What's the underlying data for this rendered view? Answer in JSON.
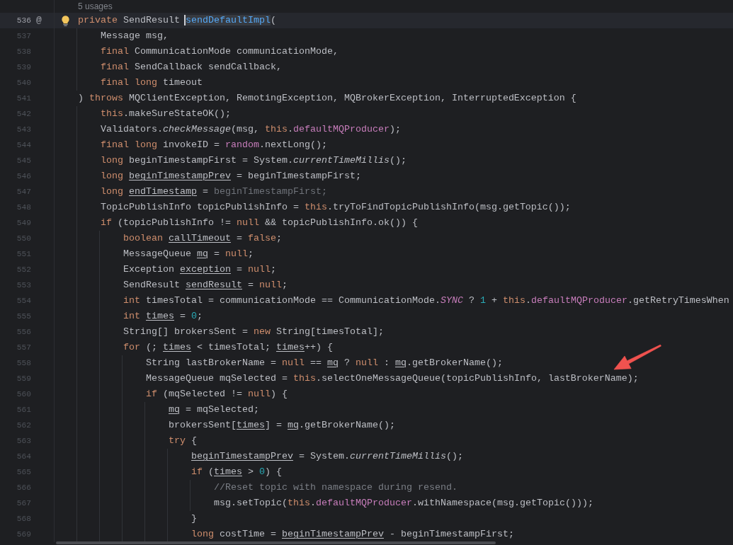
{
  "editor": {
    "lines": [
      {
        "number": "536",
        "current": true,
        "usages": "5 usages",
        "marker": "@",
        "tokens": [
          {
            "text": "private",
            "kind": "keyword"
          },
          {
            "text": " SendResult ",
            "kind": "text"
          },
          {
            "text": "sendDefaultImpl",
            "kind": "highlighted"
          },
          {
            "text": "(",
            "kind": "text"
          }
        ],
        "children": [
          {
            "number": "537",
            "current": false,
            "tokens": [
              {
                "text": "Message msg,",
                "kind": "text"
              }
            ]
          },
          {
            "number": "538",
            "current": false,
            "tokens": [
              {
                "text": "final",
                "kind": "keyword"
              },
              {
                "text": " CommunicationMode communicationMode,",
                "kind": "text"
              }
            ]
          },
          {
            "number": "539",
            "current": false,
            "tokens": [
              {
                "text": "final",
                "kind": "keyword"
              },
              {
                "text": " SendCallback sendCallback,",
                "kind": "text"
              }
            ]
          },
          {
            "number": "540",
            "current": false,
            "tokens": [
              {
                "text": "final long",
                "kind": "keyword"
              },
              {
                "text": " timeout",
                "kind": "text"
              }
            ]
          }
        ]
      },
      {
        "number": "541",
        "current": false,
        "tokens": [
          {
            "text": ") ",
            "kind": "text"
          },
          {
            "text": "throws",
            "kind": "keyword"
          },
          {
            "text": " MQClientException, RemotingException, MQBrokerException, InterruptedException {",
            "kind": "text"
          }
        ],
        "children": [
          {
            "number": "542",
            "current": false,
            "tokens": [
              {
                "text": "this",
                "kind": "keyword"
              },
              {
                "text": ".makeSureStateOK();",
                "kind": "text"
              }
            ]
          },
          {
            "number": "543",
            "current": false,
            "tokens": [
              {
                "text": "Validators.",
                "kind": "text"
              },
              {
                "text": "checkMessage",
                "kind": "static"
              },
              {
                "text": "(msg, ",
                "kind": "text"
              },
              {
                "text": "this",
                "kind": "keyword"
              },
              {
                "text": ".",
                "kind": "text"
              },
              {
                "text": "defaultMQProducer",
                "kind": "field"
              },
              {
                "text": ");",
                "kind": "text"
              }
            ]
          },
          {
            "number": "544",
            "current": false,
            "tokens": [
              {
                "text": "final long",
                "kind": "keyword"
              },
              {
                "text": " invokeID = ",
                "kind": "text"
              },
              {
                "text": "random",
                "kind": "field"
              },
              {
                "text": ".nextLong();",
                "kind": "text"
              }
            ]
          },
          {
            "number": "545",
            "current": false,
            "tokens": [
              {
                "text": "long",
                "kind": "keyword"
              },
              {
                "text": " beginTimestampFirst = System.",
                "kind": "text"
              },
              {
                "text": "currentTimeMillis",
                "kind": "static"
              },
              {
                "text": "();",
                "kind": "text"
              }
            ]
          },
          {
            "number": "546",
            "current": false,
            "tokens": [
              {
                "text": "long ",
                "kind": "keyword"
              },
              {
                "text": "beginTimestampPrev",
                "kind": "reassigned"
              },
              {
                "text": " = beginTimestampFirst;",
                "kind": "text"
              }
            ]
          },
          {
            "number": "547",
            "current": false,
            "tokens": [
              {
                "text": "long ",
                "kind": "keyword"
              },
              {
                "text": "endTimestamp",
                "kind": "reassigned"
              },
              {
                "text": " = ",
                "kind": "text"
              },
              {
                "text": "beginTimestampFirst;",
                "kind": "unused"
              }
            ]
          },
          {
            "number": "548",
            "current": false,
            "tokens": [
              {
                "text": "TopicPublishInfo topicPublishInfo = ",
                "kind": "text"
              },
              {
                "text": "this",
                "kind": "keyword"
              },
              {
                "text": ".tryToFindTopicPublishInfo(msg.getTopic());",
                "kind": "text"
              }
            ]
          },
          {
            "number": "549",
            "current": false,
            "tokens": [
              {
                "text": "if",
                "kind": "keyword"
              },
              {
                "text": " (topicPublishInfo != ",
                "kind": "text"
              },
              {
                "text": "null",
                "kind": "keyword"
              },
              {
                "text": " && topicPublishInfo.ok()) {",
                "kind": "text"
              }
            ],
            "children": [
              {
                "number": "550",
                "current": false,
                "tokens": [
                  {
                    "text": "boolean ",
                    "kind": "keyword"
                  },
                  {
                    "text": "callTimeout",
                    "kind": "reassigned"
                  },
                  {
                    "text": " = ",
                    "kind": "text"
                  },
                  {
                    "text": "false",
                    "kind": "keyword"
                  },
                  {
                    "text": ";",
                    "kind": "text"
                  }
                ]
              },
              {
                "number": "551",
                "current": false,
                "tokens": [
                  {
                    "text": "MessageQueue ",
                    "kind": "text"
                  },
                  {
                    "text": "mq",
                    "kind": "reassigned"
                  },
                  {
                    "text": " = ",
                    "kind": "text"
                  },
                  {
                    "text": "null",
                    "kind": "keyword"
                  },
                  {
                    "text": ";",
                    "kind": "text"
                  }
                ]
              },
              {
                "number": "552",
                "current": false,
                "tokens": [
                  {
                    "text": "Exception ",
                    "kind": "text"
                  },
                  {
                    "text": "exception",
                    "kind": "reassigned"
                  },
                  {
                    "text": " = ",
                    "kind": "text"
                  },
                  {
                    "text": "null",
                    "kind": "keyword"
                  },
                  {
                    "text": ";",
                    "kind": "text"
                  }
                ]
              },
              {
                "number": "553",
                "current": false,
                "tokens": [
                  {
                    "text": "SendResult ",
                    "kind": "text"
                  },
                  {
                    "text": "sendResult",
                    "kind": "reassigned"
                  },
                  {
                    "text": " = ",
                    "kind": "text"
                  },
                  {
                    "text": "null",
                    "kind": "keyword"
                  },
                  {
                    "text": ";",
                    "kind": "text"
                  }
                ]
              },
              {
                "number": "554",
                "current": false,
                "tokens": [
                  {
                    "text": "int",
                    "kind": "keyword"
                  },
                  {
                    "text": " timesTotal = communicationMode == CommunicationMode.",
                    "kind": "text"
                  },
                  {
                    "text": "SYNC",
                    "kind": "constant"
                  },
                  {
                    "text": " ? ",
                    "kind": "text"
                  },
                  {
                    "text": "1",
                    "kind": "number"
                  },
                  {
                    "text": " + ",
                    "kind": "text"
                  },
                  {
                    "text": "this",
                    "kind": "keyword"
                  },
                  {
                    "text": ".",
                    "kind": "text"
                  },
                  {
                    "text": "defaultMQProducer",
                    "kind": "field"
                  },
                  {
                    "text": ".getRetryTimesWhen",
                    "kind": "text"
                  }
                ]
              },
              {
                "number": "555",
                "current": false,
                "tokens": [
                  {
                    "text": "int ",
                    "kind": "keyword"
                  },
                  {
                    "text": "times",
                    "kind": "reassigned"
                  },
                  {
                    "text": " = ",
                    "kind": "text"
                  },
                  {
                    "text": "0",
                    "kind": "number"
                  },
                  {
                    "text": ";",
                    "kind": "text"
                  }
                ]
              },
              {
                "number": "556",
                "current": false,
                "tokens": [
                  {
                    "text": "String[] brokersSent = ",
                    "kind": "text"
                  },
                  {
                    "text": "new",
                    "kind": "keyword"
                  },
                  {
                    "text": " String[timesTotal];",
                    "kind": "text"
                  }
                ]
              },
              {
                "number": "557",
                "current": false,
                "tokens": [
                  {
                    "text": "for",
                    "kind": "keyword"
                  },
                  {
                    "text": " (; ",
                    "kind": "text"
                  },
                  {
                    "text": "times",
                    "kind": "reassigned"
                  },
                  {
                    "text": " < timesTotal; ",
                    "kind": "text"
                  },
                  {
                    "text": "times",
                    "kind": "reassigned"
                  },
                  {
                    "text": "++) {",
                    "kind": "text"
                  }
                ],
                "children": [
                  {
                    "number": "558",
                    "current": false,
                    "tokens": [
                      {
                        "text": "String lastBrokerName = ",
                        "kind": "text"
                      },
                      {
                        "text": "null",
                        "kind": "keyword"
                      },
                      {
                        "text": " == ",
                        "kind": "text"
                      },
                      {
                        "text": "mq",
                        "kind": "reassigned"
                      },
                      {
                        "text": " ? ",
                        "kind": "text"
                      },
                      {
                        "text": "null",
                        "kind": "keyword"
                      },
                      {
                        "text": " : ",
                        "kind": "text"
                      },
                      {
                        "text": "mq",
                        "kind": "reassigned"
                      },
                      {
                        "text": ".getBrokerName();",
                        "kind": "text"
                      }
                    ]
                  },
                  {
                    "number": "559",
                    "current": false,
                    "tokens": [
                      {
                        "text": "MessageQueue mqSelected = ",
                        "kind": "text"
                      },
                      {
                        "text": "this",
                        "kind": "keyword"
                      },
                      {
                        "text": ".selectOneMessageQueue(topicPublishInfo, lastBrokerName);",
                        "kind": "text"
                      }
                    ]
                  },
                  {
                    "number": "560",
                    "current": false,
                    "tokens": [
                      {
                        "text": "if",
                        "kind": "keyword"
                      },
                      {
                        "text": " (mqSelected != ",
                        "kind": "text"
                      },
                      {
                        "text": "null",
                        "kind": "keyword"
                      },
                      {
                        "text": ") {",
                        "kind": "text"
                      }
                    ],
                    "children": [
                      {
                        "number": "561",
                        "current": false,
                        "tokens": [
                          {
                            "text": "mq",
                            "kind": "reassigned"
                          },
                          {
                            "text": " = mqSelected;",
                            "kind": "text"
                          }
                        ]
                      },
                      {
                        "number": "562",
                        "current": false,
                        "tokens": [
                          {
                            "text": "brokersSent[",
                            "kind": "text"
                          },
                          {
                            "text": "times",
                            "kind": "reassigned"
                          },
                          {
                            "text": "] = ",
                            "kind": "text"
                          },
                          {
                            "text": "mq",
                            "kind": "reassigned"
                          },
                          {
                            "text": ".getBrokerName();",
                            "kind": "text"
                          }
                        ]
                      },
                      {
                        "number": "563",
                        "current": false,
                        "tokens": [
                          {
                            "text": "try",
                            "kind": "keyword"
                          },
                          {
                            "text": " {",
                            "kind": "text"
                          }
                        ],
                        "children": [
                          {
                            "number": "564",
                            "current": false,
                            "tokens": [
                              {
                                "text": "beginTimestampPrev",
                                "kind": "reassigned"
                              },
                              {
                                "text": " = System.",
                                "kind": "text"
                              },
                              {
                                "text": "currentTimeMillis",
                                "kind": "static"
                              },
                              {
                                "text": "();",
                                "kind": "text"
                              }
                            ]
                          },
                          {
                            "number": "565",
                            "current": false,
                            "tokens": [
                              {
                                "text": "if",
                                "kind": "keyword"
                              },
                              {
                                "text": " (",
                                "kind": "text"
                              },
                              {
                                "text": "times",
                                "kind": "reassigned"
                              },
                              {
                                "text": " > ",
                                "kind": "text"
                              },
                              {
                                "text": "0",
                                "kind": "number"
                              },
                              {
                                "text": ") {",
                                "kind": "text"
                              }
                            ],
                            "children": [
                              {
                                "number": "566",
                                "current": false,
                                "tokens": [
                                  {
                                    "text": "//Reset topic with namespace during resend.",
                                    "kind": "comment"
                                  }
                                ]
                              },
                              {
                                "number": "567",
                                "current": false,
                                "tokens": [
                                  {
                                    "text": "msg.setTopic(",
                                    "kind": "text"
                                  },
                                  {
                                    "text": "this",
                                    "kind": "keyword"
                                  },
                                  {
                                    "text": ".",
                                    "kind": "text"
                                  },
                                  {
                                    "text": "defaultMQProducer",
                                    "kind": "field"
                                  },
                                  {
                                    "text": ".withNamespace(msg.getTopic()));",
                                    "kind": "text"
                                  }
                                ]
                              }
                            ]
                          },
                          {
                            "number": "568",
                            "current": false,
                            "tokens": [
                              {
                                "text": "}",
                                "kind": "text"
                              }
                            ]
                          },
                          {
                            "number": "569",
                            "current": false,
                            "tokens": [
                              {
                                "text": "long",
                                "kind": "keyword"
                              },
                              {
                                "text": " costTime = ",
                                "kind": "text"
                              },
                              {
                                "text": "beginTimestampPrev",
                                "kind": "reassigned"
                              },
                              {
                                "text": " - beginTimestampFirst;",
                                "kind": "text"
                              }
                            ]
                          }
                        ]
                      }
                    ]
                  }
                ]
              }
            ]
          }
        ]
      }
    ]
  }
}
